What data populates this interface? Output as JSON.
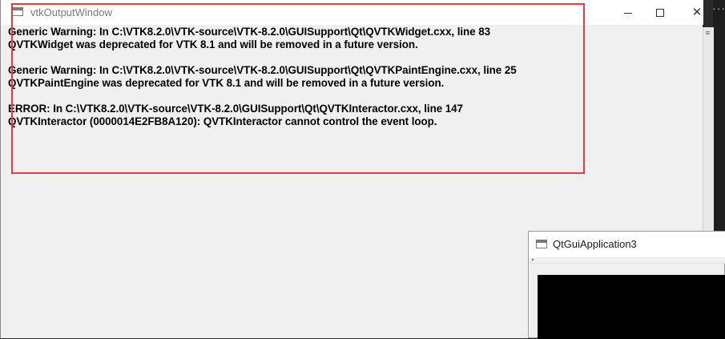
{
  "vtk_window": {
    "title": "vtkOutputWindow",
    "lines": [
      "Generic Warning: In C:\\VTK8.2.0\\VTK-source\\VTK-8.2.0\\GUISupport\\Qt\\QVTKWidget.cxx, line 83",
      "QVTKWidget was deprecated for VTK 8.1 and will be removed in a future version.",
      "Generic Warning: In C:\\VTK8.2.0\\VTK-source\\VTK-8.2.0\\GUISupport\\Qt\\QVTKPaintEngine.cxx, line 25",
      "QVTKPaintEngine was deprecated for VTK 8.1 and will be removed in a future version.",
      "ERROR: In C:\\VTK8.2.0\\VTK-source\\VTK-8.2.0\\GUISupport\\Qt\\QVTKInteractor.cxx, line 147",
      "QVTKInteractor (0000014E2FB8A120): QVTKInteractor cannot control the event loop."
    ],
    "buttons": {
      "minimize": "minimize-icon",
      "maximize": "maximize-icon",
      "close_glyph": "✕"
    }
  },
  "qt_window": {
    "title": "QtGuiApplication3"
  },
  "ide": {
    "glyph": "≡",
    "dots": "···"
  },
  "colors": {
    "highlight": "#e8383d",
    "window_bg": "#f0f0f0",
    "render_bg": "#000000"
  }
}
